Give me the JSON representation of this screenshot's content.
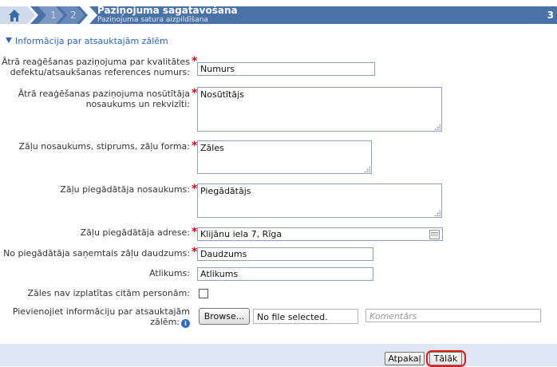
{
  "wizard": {
    "home_icon": "home-icon",
    "steps": [
      "1",
      "2"
    ],
    "title": "Paziņojuma sagatavošana",
    "subtitle": "Paziņojuma satura aizpildīšana",
    "right_step": "3"
  },
  "section": {
    "title": "Informācija par atsauktajām zālēm",
    "toggle_icon": "triangle-down-icon"
  },
  "fields": {
    "reference": {
      "label_line1": "Ātrā reaģēšanas paziņojuma par kvalitātes",
      "label_line2": "defektu/atsaukšanas references numurs:",
      "value": "Numurs"
    },
    "sender": {
      "label_line1": "Ātrā reaģēšanas paziņojuma nosūtītāja",
      "label_line2": "nosaukums un rekvizīti:",
      "value": "Nosūtītājs"
    },
    "medicine": {
      "label": "Zāļu nosaukums, stiprums, zāļu forma:",
      "value": "Zāles"
    },
    "supplier_name": {
      "label": "Zāļu piegādātāja nosaukums:",
      "value": "Piegādātājs"
    },
    "supplier_address": {
      "label": "Zāļu piegādātāja adrese:",
      "value": "Klijānu iela 7, Rīga"
    },
    "quantity": {
      "label": "No piegādātāja saņemtais zāļu daudzums:",
      "value": "Daudzums"
    },
    "remainder": {
      "label": "Atlikums:",
      "value": "Atlikums"
    },
    "not_distributed": {
      "label": "Zāles nav izplatītas citām personām:",
      "checked": false
    },
    "attachment": {
      "label_line1": "Pievienojiet informāciju par atsauktajām",
      "label_line2": "zālēm:",
      "browse_label": "Browse...",
      "file_status": "No file selected.",
      "comment_placeholder": "Komentārs"
    }
  },
  "required_mark": "*",
  "info_icon_glyph": "i",
  "footer": {
    "back_label": "Atpakaļ",
    "next_label": "Tālāk"
  },
  "colors": {
    "wizard_bar": "#4a72a6",
    "link_blue": "#2d68b0",
    "required_red": "#d0021b",
    "footer_bg": "#dfe7f4",
    "highlight": "#e01818"
  }
}
